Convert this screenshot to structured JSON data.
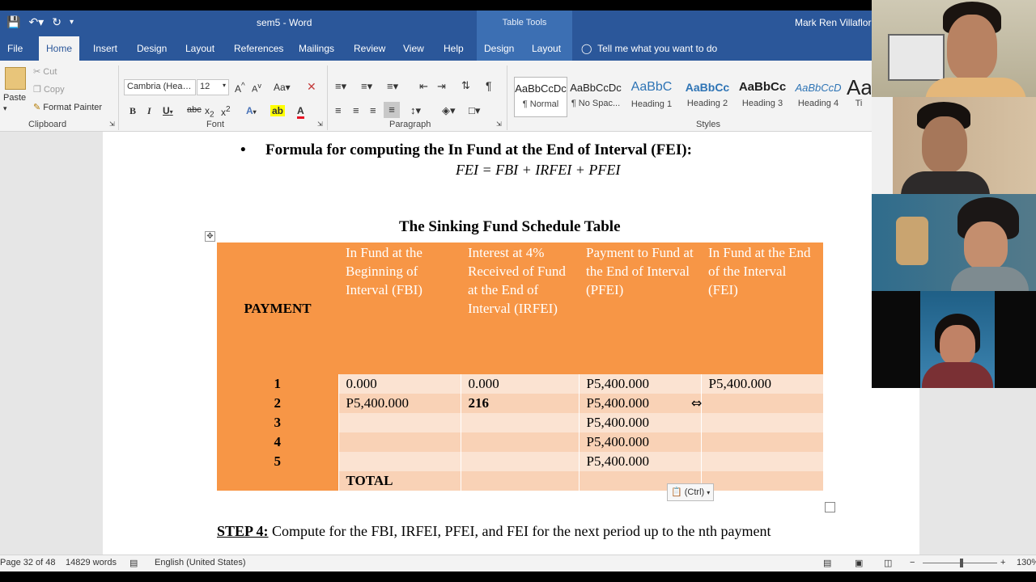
{
  "window": {
    "doc_title": "sem5 - Word",
    "table_tools": "Table Tools",
    "user": "Mark Ren Villaflor"
  },
  "tabs": [
    "File",
    "Home",
    "Insert",
    "Design",
    "Layout",
    "References",
    "Mailings",
    "Review",
    "View",
    "Help",
    "Design",
    "Layout"
  ],
  "tell_me": "Tell me what you want to do",
  "ribbon": {
    "clipboard": {
      "paste": "Paste",
      "cut": "Cut",
      "copy": "Copy",
      "format_painter": "Format Painter",
      "label": "Clipboard"
    },
    "font": {
      "name": "Cambria (Hea…",
      "size": "12",
      "label": "Font"
    },
    "paragraph": {
      "label": "Paragraph"
    },
    "styles": {
      "label": "Styles",
      "items": [
        {
          "sample": "AaBbCcDc",
          "name": "¶ Normal"
        },
        {
          "sample": "AaBbCcDc",
          "name": "¶ No Spac..."
        },
        {
          "sample": "AaBbC",
          "name": "Heading 1"
        },
        {
          "sample": "AaBbCc",
          "name": "Heading 2"
        },
        {
          "sample": "AaBbCс",
          "name": "Heading 3"
        },
        {
          "sample": "AaBbCcD",
          "name": "Heading 4"
        },
        {
          "sample": "Aa",
          "name": "Ti"
        }
      ]
    }
  },
  "document": {
    "bullet_heading": "Formula for computing the In Fund at the End of Interval (FEI):",
    "formula": "FEI = FBI + IRFEI + PFEI",
    "table_title": "The Sinking Fund Schedule Table",
    "table": {
      "headers": [
        "PAYMENT",
        "In Fund at the Beginning of Interval (FBI)",
        "Interest at 4% Received of Fund at the End of Interval (IRFEI)",
        "Payment to Fund at the End of Interval (PFEI)",
        "In Fund at the End of the Interval (FEI)"
      ],
      "rows": [
        [
          "1",
          "0.000",
          "0.000",
          "P5,400.000",
          "P5,400.000"
        ],
        [
          "2",
          "P5,400.000",
          "216",
          "P5,400.000",
          ""
        ],
        [
          "3",
          "",
          "",
          "P5,400.000",
          ""
        ],
        [
          "4",
          "",
          "",
          "P5,400.000",
          ""
        ],
        [
          "5",
          "",
          "",
          "P5,400.000",
          ""
        ]
      ],
      "total_label": "TOTAL"
    },
    "paste_options": "(Ctrl)",
    "step_label": "STEP 4:",
    "step_text": " Compute for the FBI, IRFEI, PFEI, and FEI for the next period up to the nth payment"
  },
  "status": {
    "page": "Page 32 of 48",
    "words": "14829 words",
    "language": "English (United States)",
    "zoom": "130%"
  }
}
